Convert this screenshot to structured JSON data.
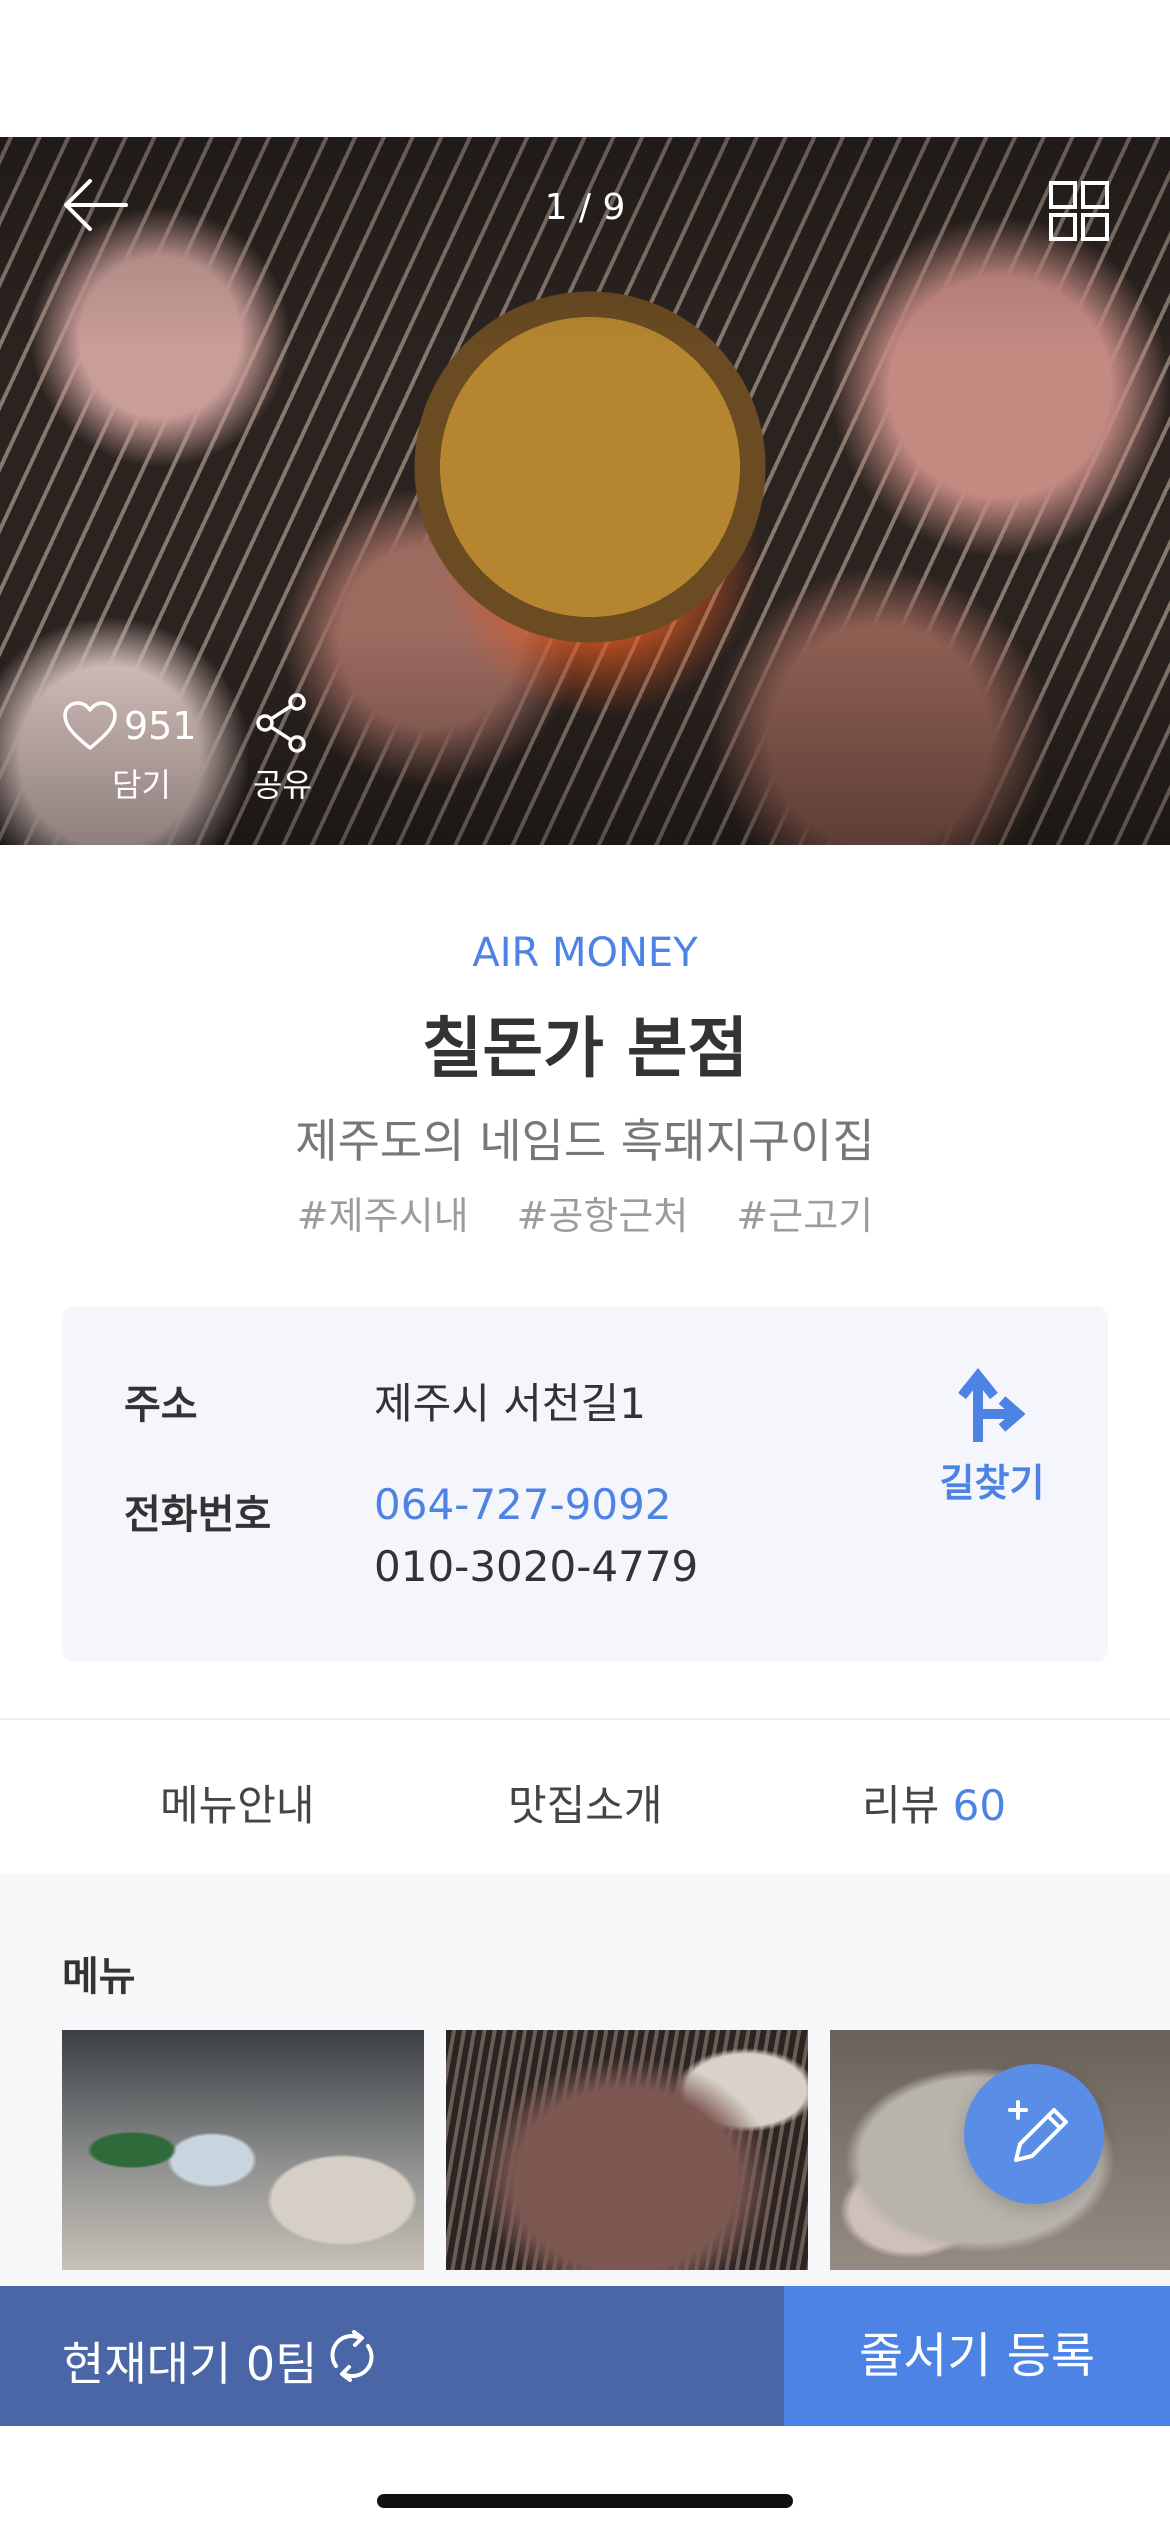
{
  "hero": {
    "image_counter": "1 / 9",
    "like_count": "951",
    "like_label": "담기",
    "share_label": "공유",
    "icons": [
      "back-arrow-icon",
      "grid-icon",
      "heart-icon",
      "share-icon"
    ]
  },
  "restaurant": {
    "brand": "AIR MONEY",
    "name": "칠돈가 본점",
    "description": "제주도의 네임드 흑돼지구이집",
    "tags": [
      "#제주시내",
      "#공항근처",
      "#근고기"
    ]
  },
  "info": {
    "address_label": "주소",
    "address": "제주시 서천길1",
    "phone_label": "전화번호",
    "phone_primary": "064-727-9092",
    "phone_secondary": "010-3020-4779",
    "directions_label": "길찾기"
  },
  "tabs": {
    "menu": "메뉴안내",
    "intro": "맛집소개",
    "review_label": "리뷰",
    "review_count": "60"
  },
  "menu_section": {
    "heading": "메뉴"
  },
  "bottom_bar": {
    "wait_text": "현재대기 0팀",
    "queue_button": "줄서기 등록"
  },
  "colors": {
    "accent": "#4c83e4",
    "bottom_bar_dark": "#4a66a6",
    "info_card_bg": "#f5f6fb"
  }
}
